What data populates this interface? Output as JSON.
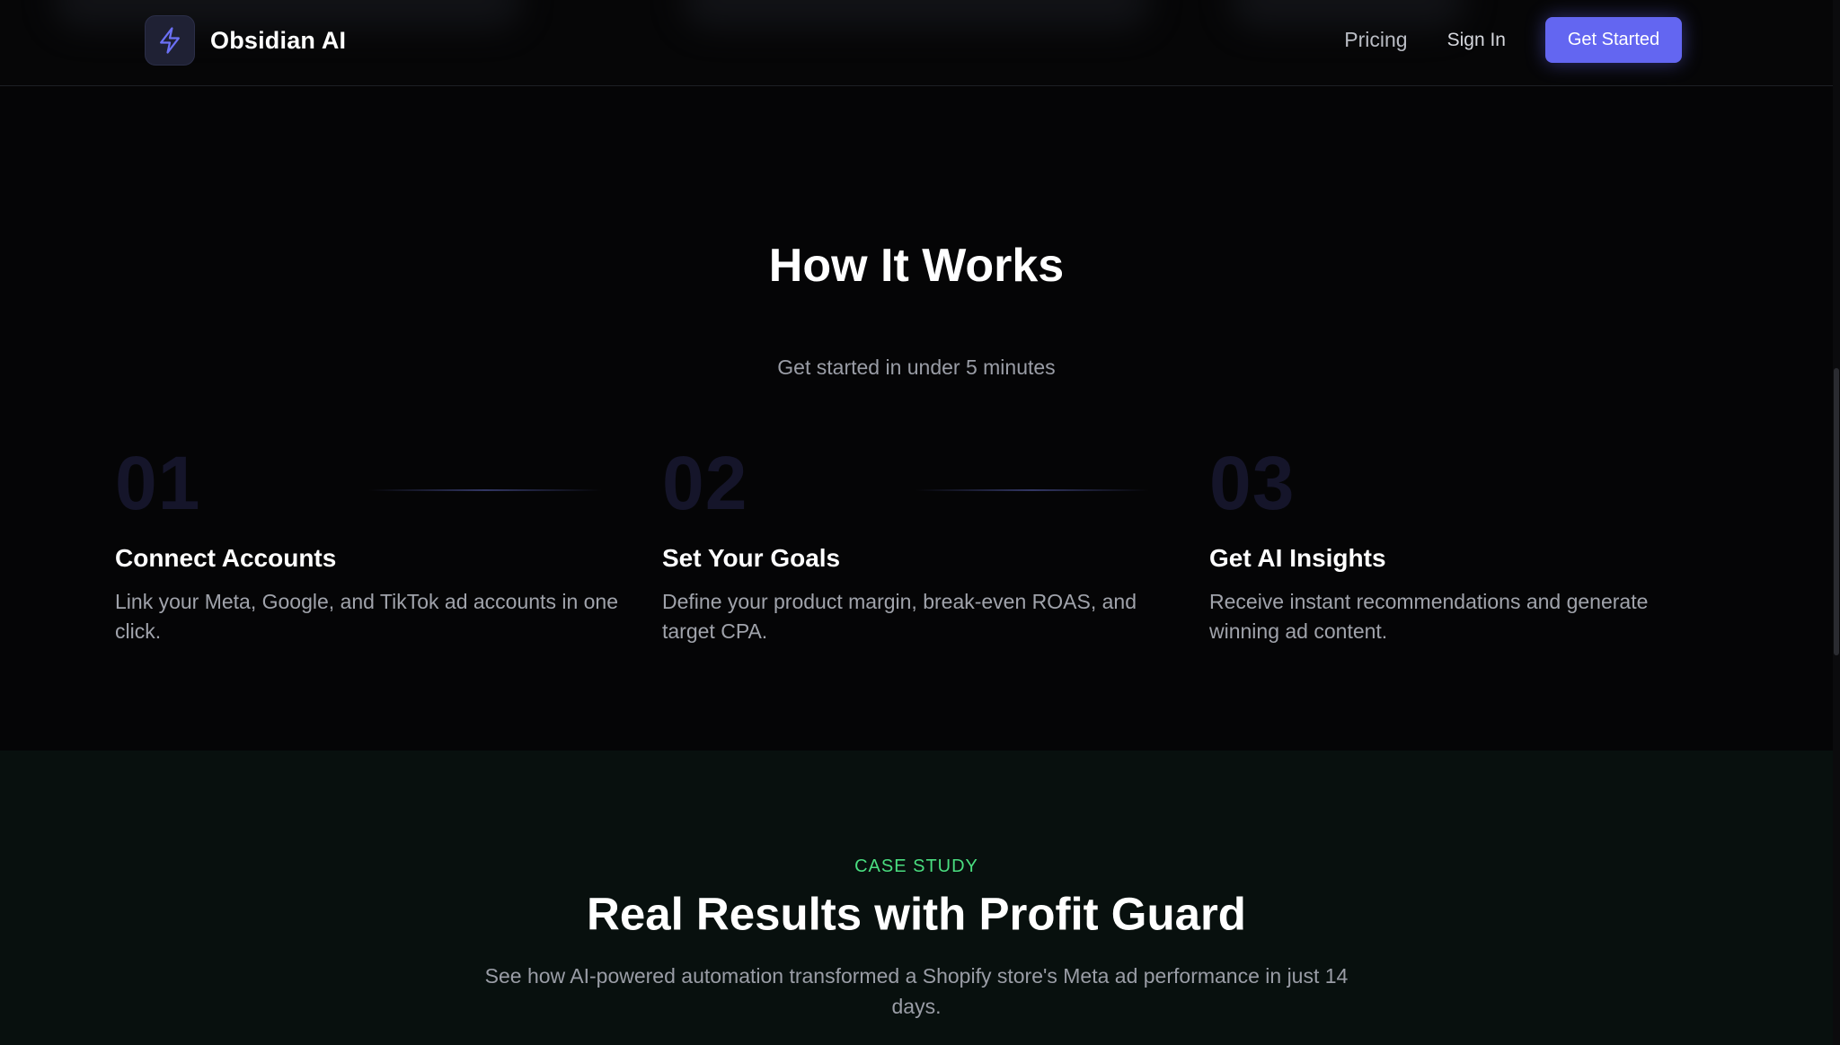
{
  "header": {
    "brand_name": "Obsidian AI",
    "logo_icon": "lightning-icon",
    "nav": {
      "pricing": "Pricing",
      "sign_in": "Sign In",
      "get_started": "Get Started"
    }
  },
  "how_it_works": {
    "title": "How It Works",
    "subtitle": "Get started in under 5 minutes",
    "steps": [
      {
        "number": "01",
        "title": "Connect Accounts",
        "description": "Link your Meta, Google, and TikTok ad accounts in one click."
      },
      {
        "number": "02",
        "title": "Set Your Goals",
        "description": "Define your product margin, break-even ROAS, and target CPA."
      },
      {
        "number": "03",
        "title": "Get AI Insights",
        "description": "Receive instant recommendations and generate winning ad content."
      }
    ]
  },
  "case_study": {
    "label": "CASE STUDY",
    "title": "Real Results with Profit Guard",
    "description": "See how AI-powered automation transformed a Shopify store's Meta ad performance in just 14 days."
  },
  "colors": {
    "accent": "#6366f1",
    "case_label": "#4ade80",
    "background": "#050506"
  }
}
